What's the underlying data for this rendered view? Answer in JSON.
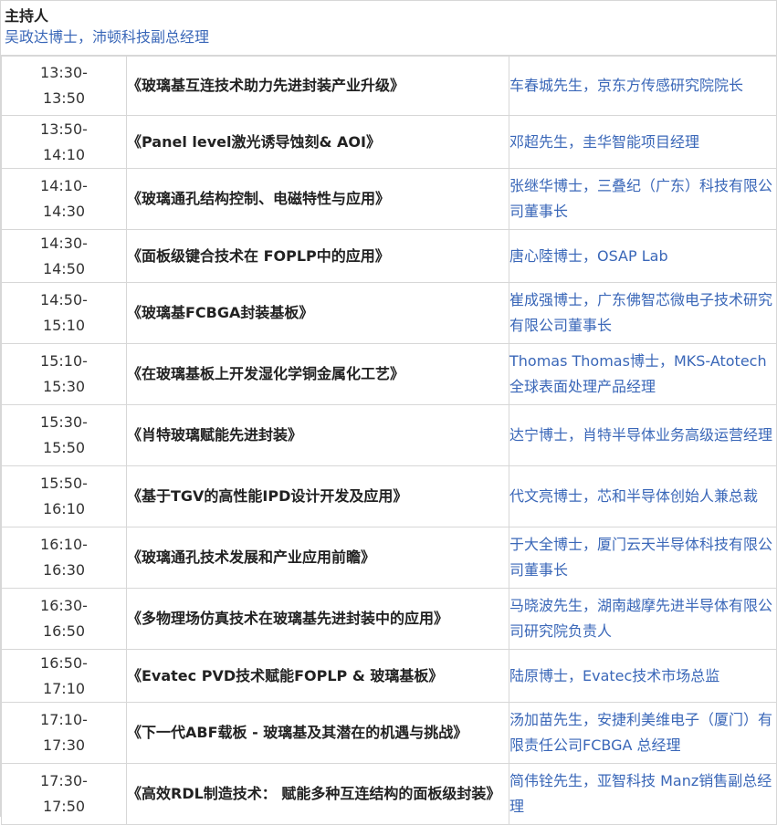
{
  "host": {
    "label": "主持人",
    "name": "吴政达博士，沛顿科技副总经理"
  },
  "sessions": [
    {
      "start": "13:30-",
      "end": "13:50",
      "title": "《玻璃基互连技术助力先进封装产业升级》",
      "speaker": "车春城先生，京东方传感研究院院长"
    },
    {
      "start": "13:50-",
      "end": "14:10",
      "title": "《Panel level激光诱导蚀刻& AOI》",
      "speaker": "邓超先生，圭华智能项目经理"
    },
    {
      "start": "14:10-",
      "end": "14:30",
      "title": "《玻璃通孔结构控制、电磁特性与应用》",
      "speaker": "张继华博士，三叠纪（广东）科技有限公司董事长"
    },
    {
      "start": "14:30-",
      "end": "14:50",
      "title": "《面板级键合技术在 FOPLP中的应用》",
      "speaker": "唐心陸博士，OSAP Lab"
    },
    {
      "start": "14:50-",
      "end": "15:10",
      "title": "《玻璃基FCBGA封装基板》",
      "speaker": "崔成强博士，广东佛智芯微电子技术研究有限公司董事长"
    },
    {
      "start": "15:10-",
      "end": "15:30",
      "title": "《在玻璃基板上开发湿化学铜金属化工艺》",
      "speaker": "Thomas Thomas博士，MKS-Atotech全球表面处理产品经理"
    },
    {
      "start": "15:30-",
      "end": "15:50",
      "title": "《肖特玻璃赋能先进封装》",
      "speaker": "达宁博士，肖特半导体业务高级运营经理"
    },
    {
      "start": "15:50-",
      "end": "16:10",
      "title": "《基于TGV的高性能IPD设计开发及应用》",
      "speaker": "代文亮博士，芯和半导体创始人兼总裁"
    },
    {
      "start": "16:10-",
      "end": "16:30",
      "title": "《玻璃通孔技术发展和产业应用前瞻》",
      "speaker": "于大全博士，厦门云天半导体科技有限公司董事长"
    },
    {
      "start": "16:30-",
      "end": "16:50",
      "title": "《多物理场仿真技术在玻璃基先进封装中的应用》",
      "speaker": "马晓波先生，湖南越摩先进半导体有限公司研究院负责人"
    },
    {
      "start": "16:50-",
      "end": "17:10",
      "title": "《Evatec PVD技术赋能FOPLP & 玻璃基板》",
      "speaker": "陆原博士，Evatec技术市场总监"
    },
    {
      "start": "17:10-",
      "end": "17:30",
      "title": "《下一代ABF载板 - 玻璃基及其潜在的机遇与挑战》",
      "speaker": "汤加苗先生，安捷利美维电子（厦门）有限责任公司FCBGA 总经理"
    },
    {
      "start": "17:30-",
      "end": "17:50",
      "title": "《高效RDL制造技术： 赋能多种互连结构的面板级封装》",
      "speaker": "简伟铨先生，亚智科技 Manz销售副总经理"
    }
  ]
}
